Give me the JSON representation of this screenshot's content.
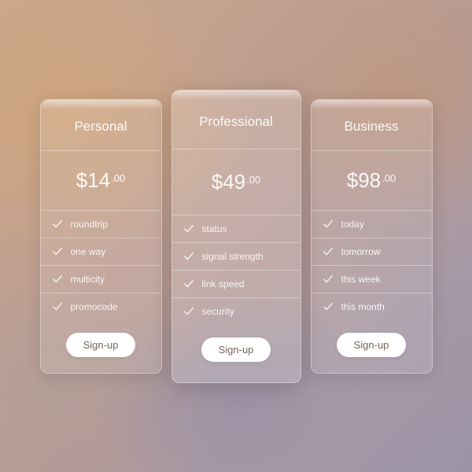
{
  "plans": [
    {
      "title": "Personal",
      "price_main": "$14",
      "price_cents": ".00",
      "features": [
        "roundtrip",
        "one way",
        "multicity",
        "promocode"
      ],
      "cta": "Sign-up",
      "featured": false
    },
    {
      "title": "Professional",
      "price_main": "$49",
      "price_cents": ".00",
      "features": [
        "status",
        "signal strength",
        "link speed",
        "security"
      ],
      "cta": "Sign-up",
      "featured": true
    },
    {
      "title": "Business",
      "price_main": "$98",
      "price_cents": ".00",
      "features": [
        "today",
        "tomorrow",
        "this week",
        "this month"
      ],
      "cta": "Sign-up",
      "featured": false
    }
  ]
}
